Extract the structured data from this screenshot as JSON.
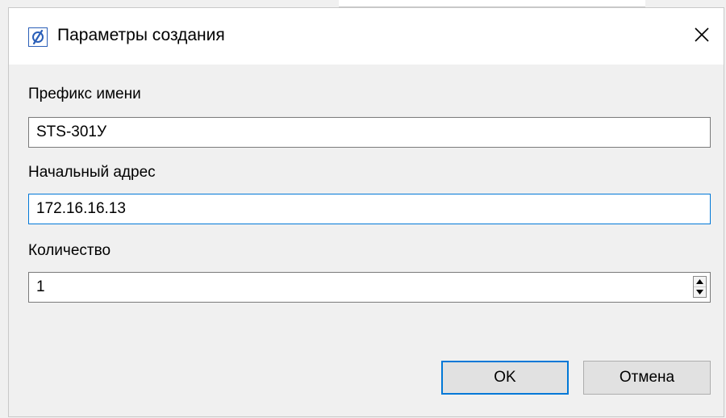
{
  "dialog": {
    "title": "Параметры создания",
    "icon": "app-logo-icon",
    "close_icon": "close-icon"
  },
  "fields": {
    "prefix": {
      "label": "Префикс имени",
      "value": "STS-301У"
    },
    "start_address": {
      "label": "Начальный адрес",
      "value": "172.16.16.13"
    },
    "count": {
      "label": "Количество",
      "value": "1"
    }
  },
  "buttons": {
    "ok_label": "OK",
    "cancel_label": "Отмена"
  },
  "colors": {
    "focus_accent": "#0078d7",
    "dialog_bg": "#f0f0f0",
    "titlebar_bg": "#ffffff"
  }
}
